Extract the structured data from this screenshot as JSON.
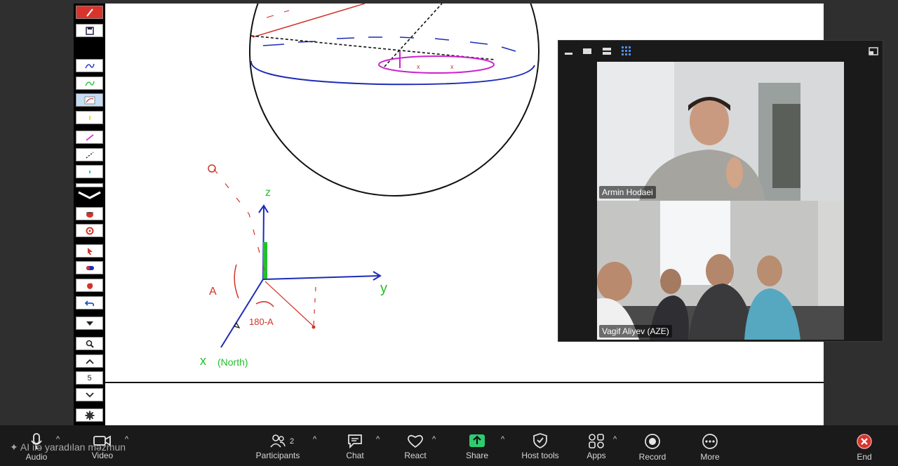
{
  "participants": {
    "count": "2",
    "tile1_name": "Armin Hodaei",
    "tile2_name": "Vagif Aliyev (AZE)"
  },
  "toolbar": {
    "page_number": "5"
  },
  "bottom_bar": {
    "audio": "Audio",
    "video": "Video",
    "participants": "Participants",
    "chat": "Chat",
    "react": "React",
    "share": "Share",
    "host_tools": "Host tools",
    "apps": "Apps",
    "record": "Record",
    "more": "More",
    "end": "End"
  },
  "ai_notice": "AI ilə yaradılan məzmun",
  "drawing_labels": {
    "axis_z": "z",
    "axis_y": "y",
    "axis_x": "x",
    "north": "(North)",
    "angle_a": "A",
    "angle_180": "180-A",
    "x_mark": "x"
  },
  "colors": {
    "share_green": "#2ecc71",
    "end_red": "#d9342b",
    "pen_blue": "#1d2bb8",
    "pen_green": "#22c02a",
    "pen_red": "#d0342b",
    "pen_magenta": "#cc22cc"
  }
}
